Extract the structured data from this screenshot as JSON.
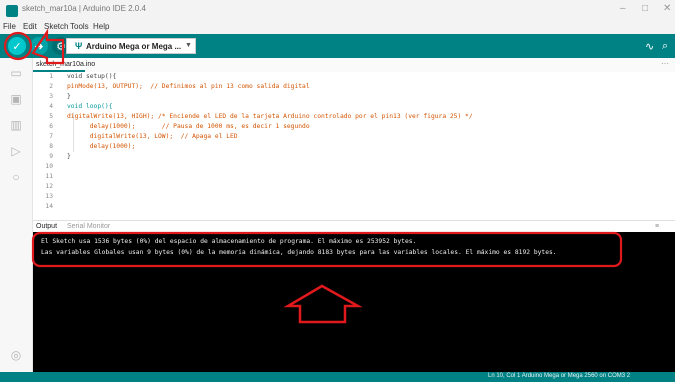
{
  "window": {
    "title": "sketch_mar10a | Arduino IDE 2.0.4",
    "minimize": "–",
    "maximize": "□",
    "close": "✕"
  },
  "menu": [
    "File",
    "Edit",
    "Sketch",
    "Tools",
    "Help"
  ],
  "toolbar": {
    "verify_icon": "check-icon",
    "upload_icon": "arrow-right-icon",
    "debug_icon": "debug-icon",
    "board_selected": "Arduino Mega or Mega ...",
    "serial_plotter_icon": "plotter-icon",
    "serial_monitor_icon": "monitor-icon"
  },
  "sidebar": [
    "folder-icon",
    "boards-icon",
    "library-icon",
    "debug-icon",
    "search-icon",
    "account-icon"
  ],
  "tab": {
    "filename": "sketch_mar10a.ino",
    "more": "···"
  },
  "editor": {
    "lines": [
      "void setup(){",
      "pinMode(13, OUTPUT);  // Definimos al pin 13 como salida digital",
      "}",
      "void loop(){",
      "digitalWrite(13, HIGH); /* Enciende el LED de la tarjeta Arduino controlado por el pin13 (ver figura 25) */",
      "      delay(1000);       // Pausa de 1000 ms, es decir 1 segundo",
      "      digitalWrite(13, LOW);  // Apaga el LED",
      "      delay(1000);",
      "}",
      "",
      "",
      "",
      "",
      ""
    ]
  },
  "output_panel": {
    "tabs": [
      "Output",
      "Serial Monitor"
    ],
    "messages": [
      "El Sketch usa 1536 bytes (0%) del espacio de almacenamiento de programa. El máximo es 253952 bytes.",
      "Las variables Globales usan 9 bytes (0%) de la memoria dinámica, dejando 8183 bytes para las variables locales. El máximo es 8192 bytes."
    ]
  },
  "status_bar": {
    "text": "Ln 10, Col 1   Arduino Mega or Mega 2560 on COM3   2"
  },
  "colors": {
    "teal": "#008184",
    "annotation_red": "#e0191d"
  }
}
